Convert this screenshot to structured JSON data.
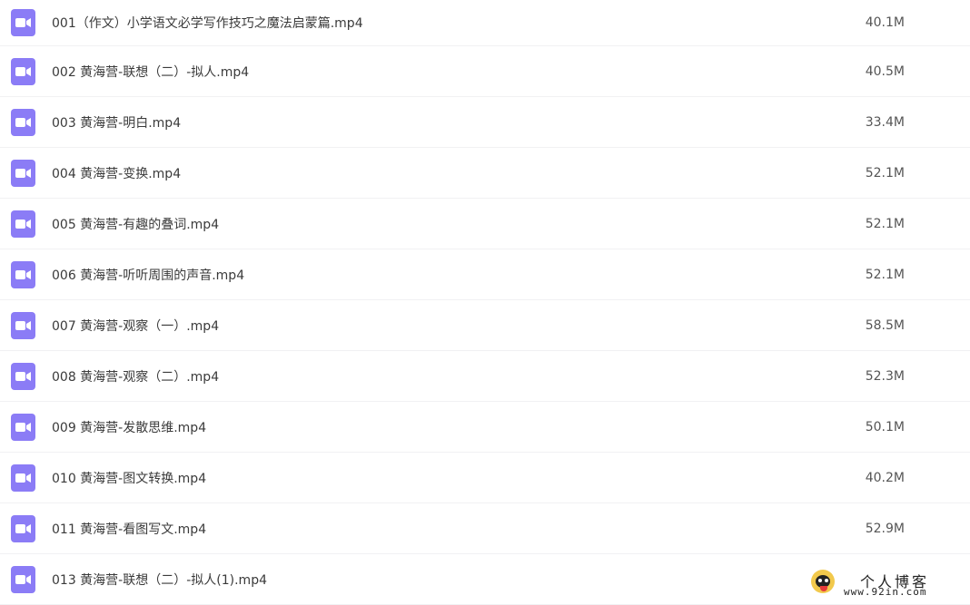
{
  "files": [
    {
      "name": "001（作文）小学语文必学写作技巧之魔法启蒙篇.mp4",
      "size": "40.1M",
      "icon": "video-file-icon"
    },
    {
      "name": "002 黄海营-联想（二）-拟人.mp4",
      "size": "40.5M",
      "icon": "video-file-icon"
    },
    {
      "name": "003 黄海营-明白.mp4",
      "size": "33.4M",
      "icon": "video-file-icon"
    },
    {
      "name": "004 黄海营-变换.mp4",
      "size": "52.1M",
      "icon": "video-file-icon"
    },
    {
      "name": "005 黄海营-有趣的叠词.mp4",
      "size": "52.1M",
      "icon": "video-file-icon"
    },
    {
      "name": "006 黄海营-听听周围的声音.mp4",
      "size": "52.1M",
      "icon": "video-file-icon"
    },
    {
      "name": "007 黄海营-观察（一）.mp4",
      "size": "58.5M",
      "icon": "video-file-icon"
    },
    {
      "name": "008 黄海营-观察（二）.mp4",
      "size": "52.3M",
      "icon": "video-file-icon"
    },
    {
      "name": "009 黄海营-发散思维.mp4",
      "size": "50.1M",
      "icon": "video-file-icon"
    },
    {
      "name": "010 黄海营-图文转换.mp4",
      "size": "40.2M",
      "icon": "video-file-icon"
    },
    {
      "name": "011 黄海营-看图写文.mp4",
      "size": "52.9M",
      "icon": "video-file-icon"
    },
    {
      "name": "013 黄海营-联想（二）-拟人(1).mp4",
      "size": "",
      "icon": "video-file-icon"
    }
  ],
  "watermark": {
    "title": "个人博客",
    "url": "www.92in.com"
  },
  "colors": {
    "icon_bg": "#8b7cf6",
    "row_divider": "#f1f1f3",
    "text": "#3a3a3a"
  }
}
